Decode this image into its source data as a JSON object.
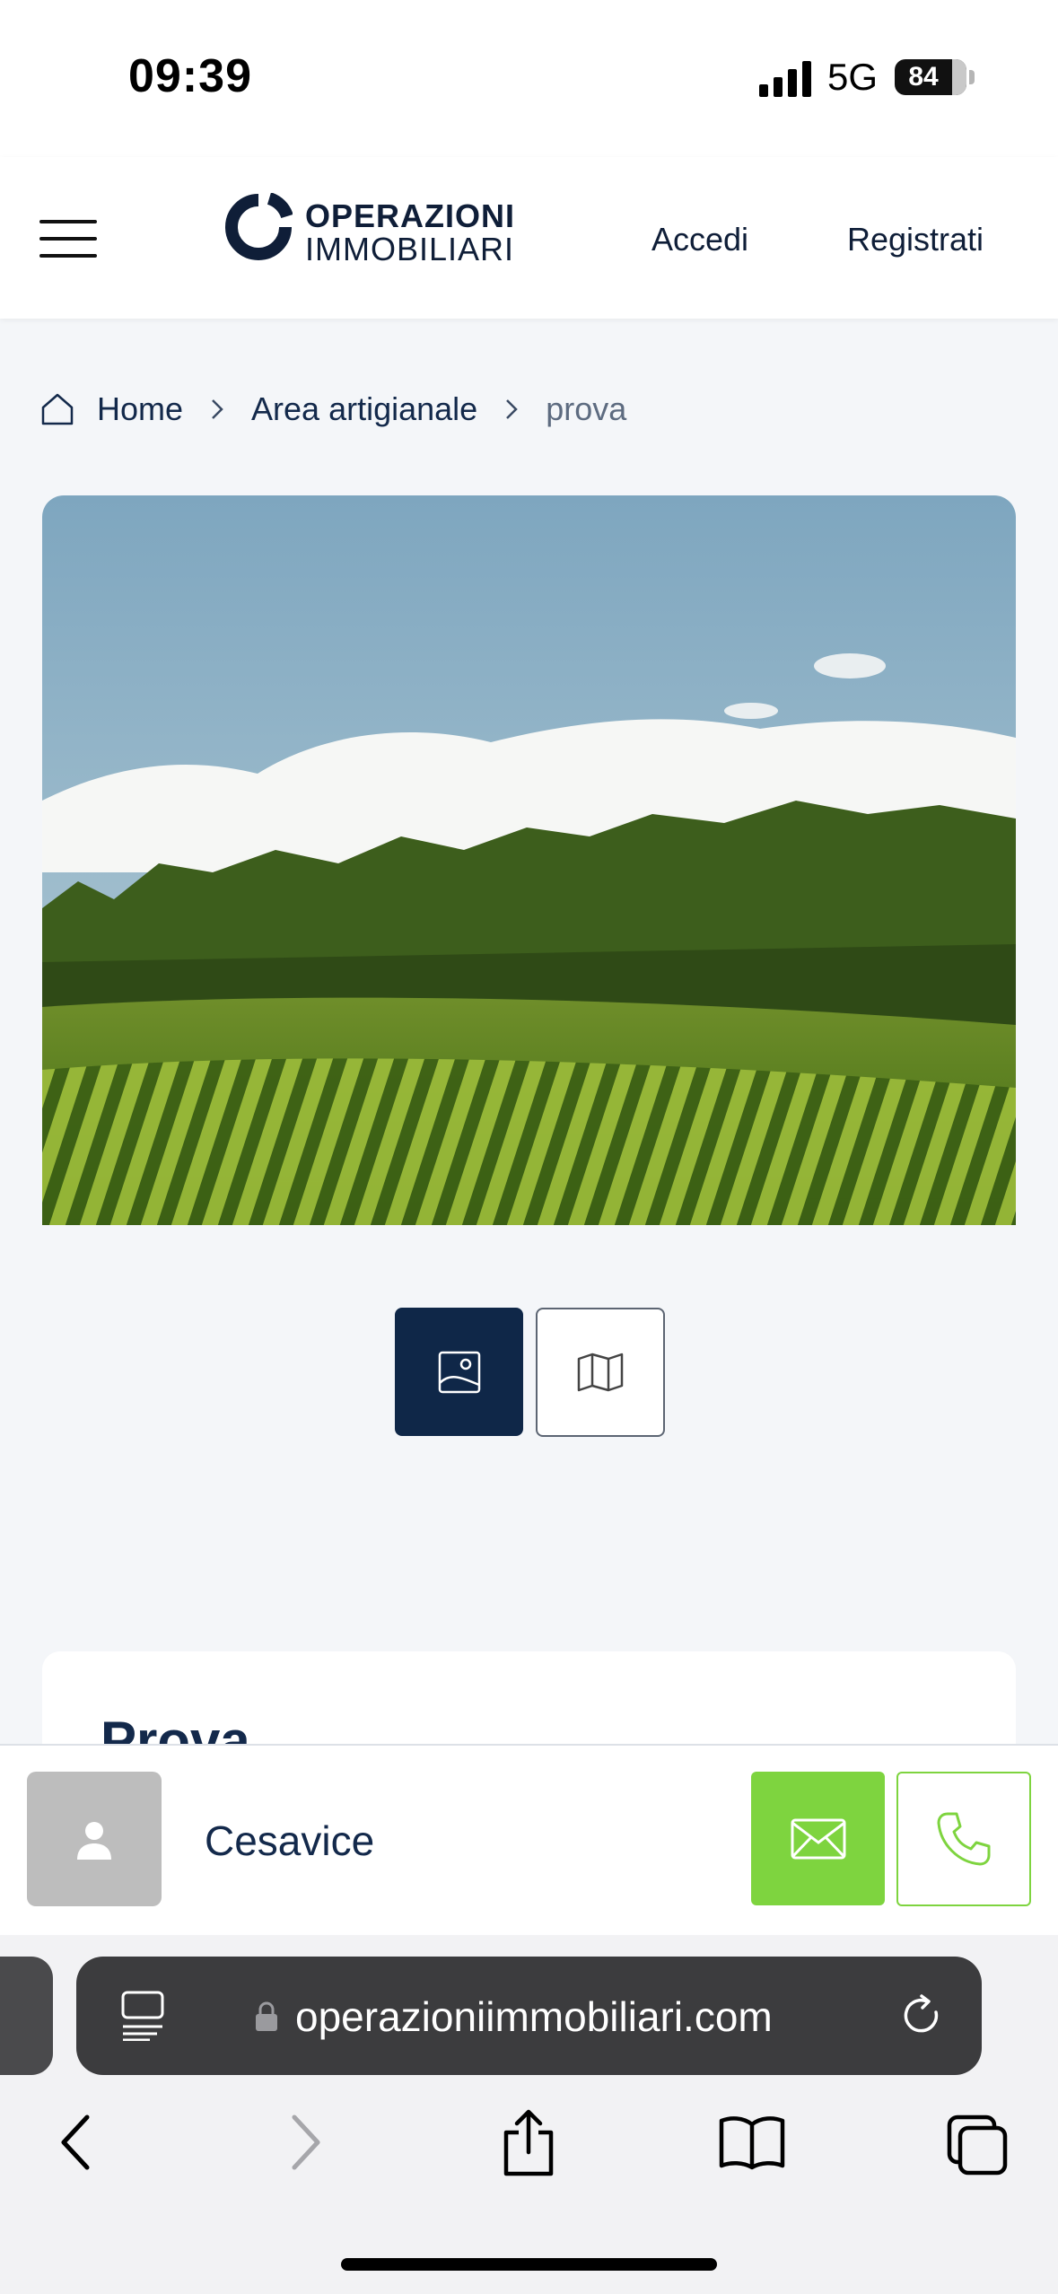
{
  "status_bar": {
    "time": "09:39",
    "network": "5G",
    "battery": "84"
  },
  "header": {
    "logo_line1": "OPERAZIONI",
    "logo_line2": "IMMOBILIARI",
    "login_label": "Accedi",
    "register_label": "Registrati"
  },
  "breadcrumb": {
    "items": [
      "Home",
      "Area artigianale",
      "prova"
    ]
  },
  "listing": {
    "title": "Prova"
  },
  "agent": {
    "name": "Cesavice"
  },
  "browser": {
    "url": "operazioniimmobiliari.com"
  },
  "colors": {
    "navy": "#0f2748",
    "accent_green": "#7ed43f",
    "page_bg": "#f4f6f9"
  },
  "icons": [
    "menu-icon",
    "home-icon",
    "chevron-right-icon",
    "image-icon",
    "map-icon",
    "person-icon",
    "mail-icon",
    "phone-icon",
    "lock-icon",
    "reader-icon",
    "reload-icon",
    "back-icon",
    "forward-icon",
    "share-icon",
    "bookmarks-icon",
    "tabs-icon"
  ]
}
